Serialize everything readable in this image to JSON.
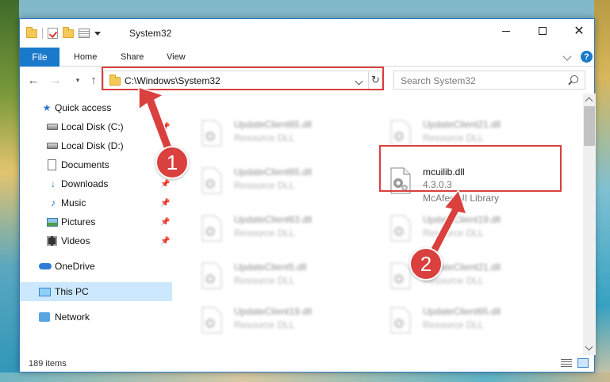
{
  "window": {
    "title": "System32",
    "minimize_icon": "minimize-icon",
    "maximize_icon": "maximize-icon",
    "close_icon": "close-icon"
  },
  "ribbon": {
    "tabs": [
      {
        "label": "File"
      },
      {
        "label": "Home"
      },
      {
        "label": "Share"
      },
      {
        "label": "View"
      }
    ],
    "help_label": "?"
  },
  "address": {
    "path": "C:\\Windows\\System32"
  },
  "search": {
    "placeholder": "Search System32"
  },
  "sidebar": {
    "items": [
      {
        "label": "Quick access",
        "icon": "star-icon"
      },
      {
        "label": "Local Disk (C:)",
        "icon": "drive-icon",
        "pinned": true
      },
      {
        "label": "Local Disk (D:)",
        "icon": "drive-icon"
      },
      {
        "label": "Documents",
        "icon": "documents-icon",
        "pinned": true
      },
      {
        "label": "Downloads",
        "icon": "downloads-icon",
        "pinned": true
      },
      {
        "label": "Music",
        "icon": "music-icon",
        "pinned": true
      },
      {
        "label": "Pictures",
        "icon": "pictures-icon",
        "pinned": true
      },
      {
        "label": "Videos",
        "icon": "videos-icon",
        "pinned": true
      },
      {
        "label": "OneDrive",
        "icon": "onedrive-icon"
      },
      {
        "label": "This PC",
        "icon": "this-pc-icon",
        "selected": true
      },
      {
        "label": "Network",
        "icon": "network-icon"
      }
    ]
  },
  "files": [
    {
      "name": "UpdateClient65.dll",
      "desc": "Resource DLL"
    },
    {
      "name": "UpdateClient21.dll",
      "desc": "Resource DLL"
    },
    {
      "name": "UpdateClient65.dll",
      "desc": "Resource DLL"
    },
    {
      "name": "mcuilib.dll",
      "version": "4.3.0.3",
      "desc": "McAfee UI Library"
    },
    {
      "name": "UpdateClient63.dll",
      "desc": "Resource DLL"
    },
    {
      "name": "UpdateClient19.dll",
      "desc": "Resource DLL"
    },
    {
      "name": "UpdateClient5.dll",
      "desc": "Resource DLL"
    },
    {
      "name": "UpdateClient21.dll",
      "desc": "Resource DLL"
    },
    {
      "name": "UpdateClient19.dll",
      "desc": "Resource DLL"
    },
    {
      "name": "UpdateClient65.dll",
      "desc": "Resource DLL"
    }
  ],
  "status": {
    "item_count": "189 items"
  },
  "callouts": [
    {
      "label": "1"
    },
    {
      "label": "2"
    }
  ],
  "colors": {
    "accent": "#1979ca",
    "highlight": "#d9403e",
    "selected": "#cce8ff"
  }
}
